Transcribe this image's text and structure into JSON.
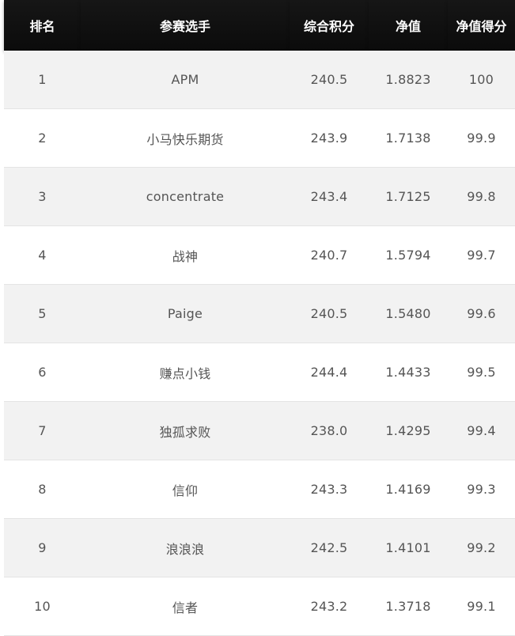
{
  "table": {
    "headers": [
      "排名",
      "参赛选手",
      "综合积分",
      "净值",
      "净值得分"
    ],
    "rows": [
      [
        "1",
        "APM",
        "240.5",
        "1.8823",
        "100"
      ],
      [
        "2",
        "小马快乐期货",
        "243.9",
        "1.7138",
        "99.9"
      ],
      [
        "3",
        "concentrate",
        "243.4",
        "1.7125",
        "99.8"
      ],
      [
        "4",
        "战神",
        "240.7",
        "1.5794",
        "99.7"
      ],
      [
        "5",
        "Paige",
        "240.5",
        "1.5480",
        "99.6"
      ],
      [
        "6",
        "赚点小钱",
        "244.4",
        "1.4433",
        "99.5"
      ],
      [
        "7",
        "独孤求败",
        "238.0",
        "1.4295",
        "99.4"
      ],
      [
        "8",
        "信仰",
        "243.3",
        "1.4169",
        "99.3"
      ],
      [
        "9",
        "浪浪浪",
        "242.5",
        "1.4101",
        "99.2"
      ],
      [
        "10",
        "信者",
        "243.2",
        "1.3718",
        "99.1"
      ]
    ]
  }
}
